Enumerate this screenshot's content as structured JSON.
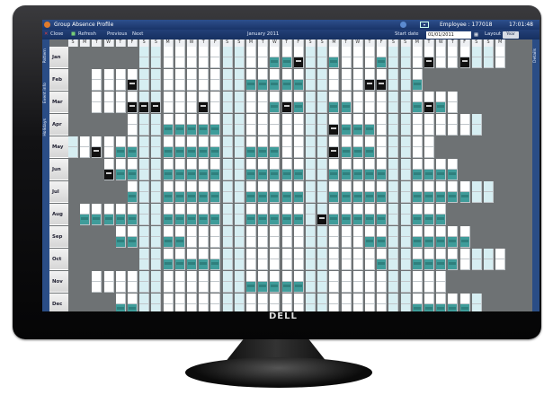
{
  "app": {
    "title": "Group Absence Profile",
    "employee": "Employee : 177018",
    "time": "17:01:48"
  },
  "toolbar": {
    "close": "Close",
    "refresh": "Refresh",
    "previous": "Previous",
    "next": "Next",
    "period": "January 2011",
    "start_date_label": "Start date",
    "start_date": "01/01/2011",
    "layout_label": "Layout",
    "layout_value": "Year"
  },
  "sidebar": {
    "items": [
      "Pattern",
      "Event info",
      "Holidays"
    ]
  },
  "right_sidebar": {
    "items": [
      "Details"
    ]
  },
  "weekdays": [
    "S",
    "M",
    "T",
    "W",
    "T",
    "F",
    "S",
    "S",
    "M",
    "T",
    "W",
    "T",
    "F",
    "S",
    "S",
    "M",
    "T",
    "W",
    "T",
    "F",
    "S",
    "S",
    "M",
    "T",
    "W",
    "T",
    "F",
    "S",
    "S",
    "M",
    "T",
    "W",
    "T",
    "F",
    "S",
    "S",
    "M"
  ],
  "months": [
    "Jan",
    "Feb",
    "Mar",
    "Apr",
    "May",
    "Jun",
    "Jul",
    "Aug",
    "Sep",
    "Oct",
    "Nov",
    "Dec"
  ],
  "brand": "DELL",
  "colors": {
    "absence": "#3f9c9a",
    "public_holiday": "#111111",
    "weekend": "#d6eef2",
    "title_bar": "#1a3468"
  }
}
